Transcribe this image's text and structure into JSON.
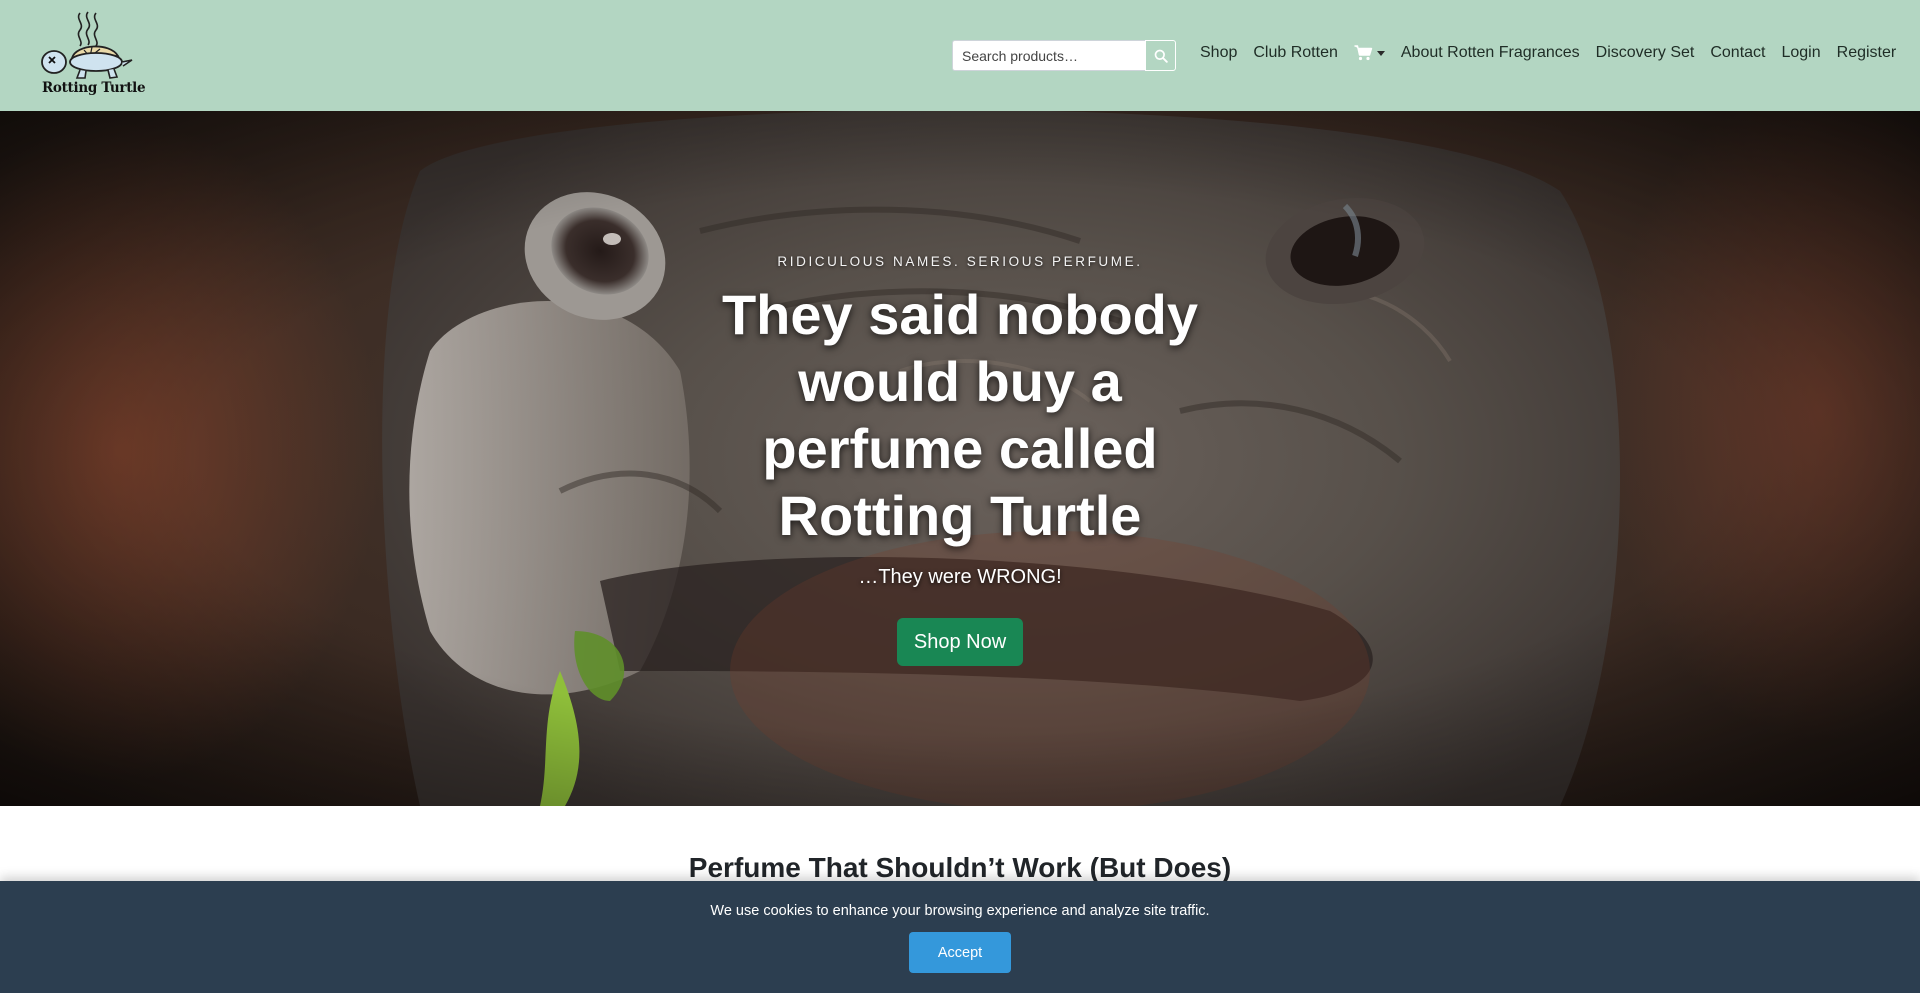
{
  "brand": {
    "name": "Rotting Turtle"
  },
  "search": {
    "placeholder": "Search products…"
  },
  "nav": {
    "items": [
      {
        "label": "Shop"
      },
      {
        "label": "Club Rotten"
      },
      {
        "label": "About Rotten Fragrances"
      },
      {
        "label": "Discovery Set"
      },
      {
        "label": "Contact"
      },
      {
        "label": "Login"
      },
      {
        "label": "Register"
      }
    ]
  },
  "hero": {
    "eyebrow": "RIDICULOUS NAMES. SERIOUS PERFUME.",
    "headline": "They said nobody would buy a perfume called Rotting Turtle",
    "subline": "…They were WRONG!",
    "cta": "Shop Now"
  },
  "section": {
    "title": "Perfume That Shouldn’t Work (But Does)"
  },
  "cookie": {
    "message": "We use cookies to enhance your browsing experience and analyze site traffic.",
    "accept_label": "Accept"
  },
  "colors": {
    "header_bg": "#b3d6c2",
    "cta_green": "#198754",
    "cookie_bg": "#2c3e50",
    "accept_blue": "#3498db"
  },
  "icons": {
    "search": "search-icon",
    "cart": "cart-icon",
    "logo": "turtle-logo-icon"
  }
}
